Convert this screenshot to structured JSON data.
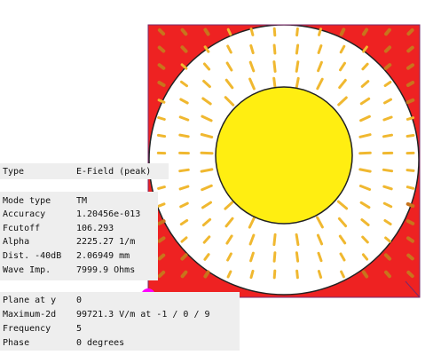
{
  "viewer": {
    "field_type": {
      "label": "Type",
      "value": "E-Field (peak)"
    },
    "mode_info": [
      {
        "label": "Mode type",
        "value": "TM"
      },
      {
        "label": "Accuracy",
        "value": "1.20456e-013"
      },
      {
        "label": "Fcutoff",
        "value": "106.293"
      },
      {
        "label": "Alpha",
        "value": "2225.27 1/m"
      },
      {
        "label": "Dist. -40dB",
        "value": "2.06949 mm"
      },
      {
        "label": "Wave Imp.",
        "value": "7999.9 Ohms"
      }
    ],
    "plane_info": [
      {
        "label": "Plane at y",
        "value": "0"
      },
      {
        "label": "Maximum-2d",
        "value": "99721.3 V/m at -1 / 0 / 9"
      },
      {
        "label": "Frequency",
        "value": "5"
      },
      {
        "label": "Phase",
        "value": "0 degrees"
      }
    ]
  },
  "colors": {
    "outer_conductor": "#ee2222",
    "dielectric": "#ffffff",
    "inner_conductor": "#ffee11",
    "arrow_light": "#f0b830",
    "arrow_dark": "#c8741c",
    "frame": "#7a2a6a",
    "origin_marker": "#ff00ff"
  }
}
